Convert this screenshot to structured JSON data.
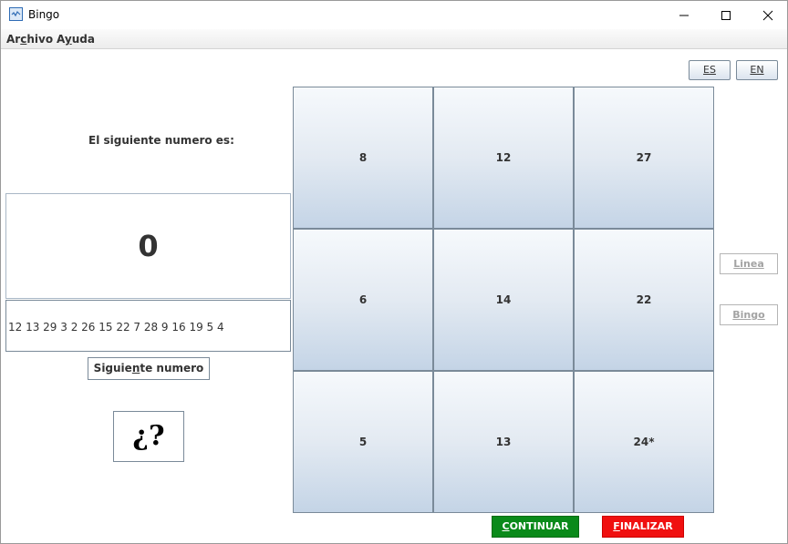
{
  "window": {
    "title": "Bingo"
  },
  "menu": {
    "items": [
      {
        "pre": "Ar",
        "u": "c",
        "post": "hivo"
      },
      {
        "pre": "A",
        "u": "y",
        "post": "uda"
      }
    ]
  },
  "lang": {
    "es": "ES",
    "en": "EN"
  },
  "left": {
    "next_label": "El siguiente numero es:",
    "current_number": "0",
    "history": "12 13 29 3 2 26 15 22 7 28 9 16 19 5 4",
    "next_button": {
      "pre": "Siguie",
      "u": "n",
      "post": "te numero"
    },
    "mystery": "¿?"
  },
  "card": {
    "cells": [
      "8",
      "12",
      "27",
      "6",
      "14",
      "22",
      "5",
      "13",
      "24*"
    ]
  },
  "side": {
    "linea": "Linea",
    "bingo": "Bingo"
  },
  "bottom": {
    "continuar": {
      "u": "C",
      "post": "ONTINUAR"
    },
    "finalizar": {
      "u": "F",
      "post": "INALIZAR"
    }
  },
  "colors": {
    "continuar_bg": "#0a8a1a",
    "finalizar_bg": "#f01010"
  }
}
